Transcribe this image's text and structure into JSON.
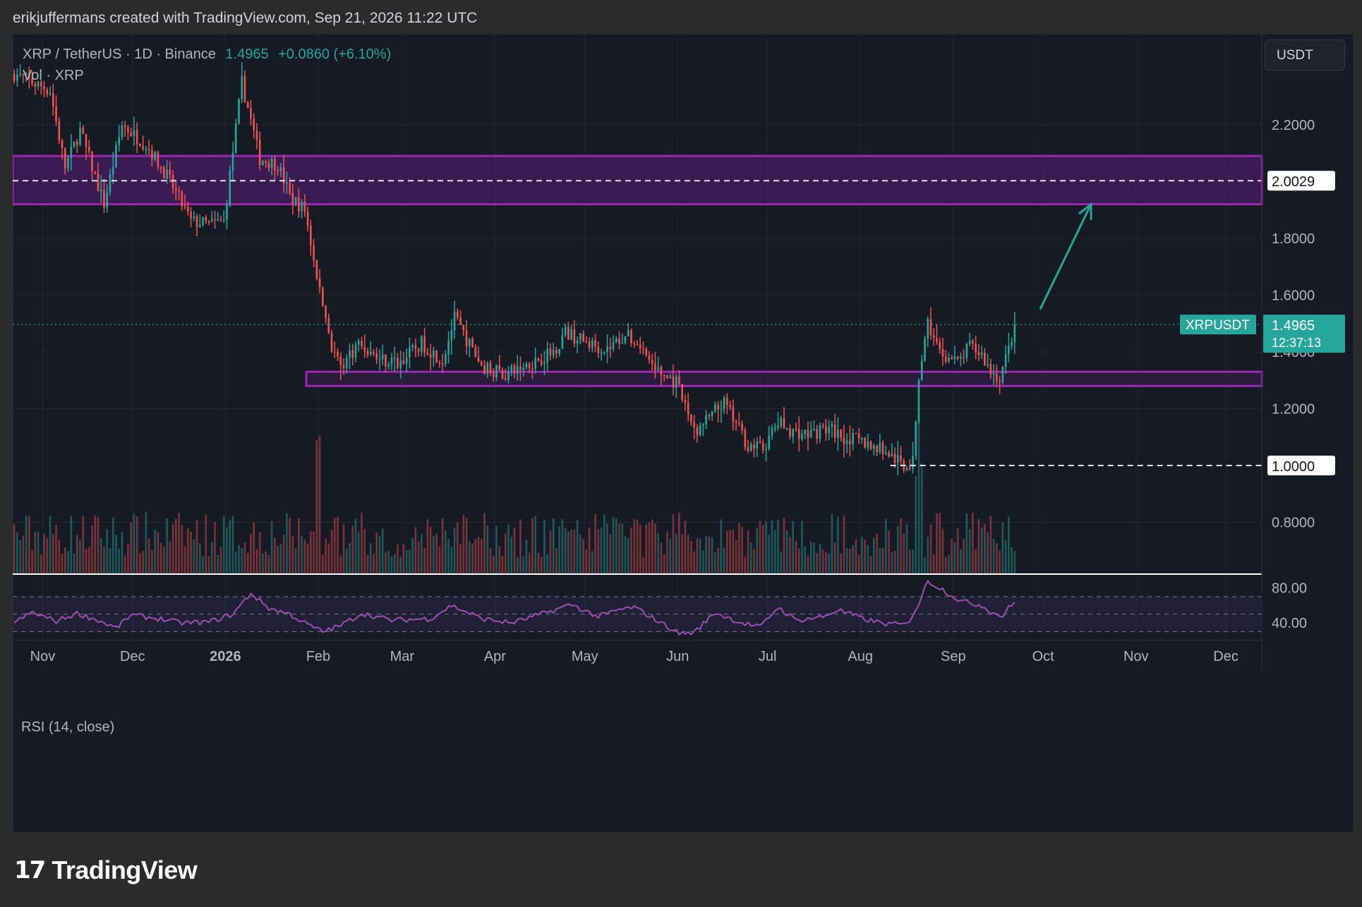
{
  "header": {
    "attribution": "erikjuffermans created with TradingView.com, Sep 21, 2026 11:22 UTC"
  },
  "legend": {
    "symbol": "XRP / TetherUS · 1D · Binance",
    "price": "1.4965",
    "change": "+0.0860 (+6.10%)",
    "volume_label": "Vol · XRP"
  },
  "currency_button": "USDT",
  "rsi_label": "RSI (14, close)",
  "footer": {
    "brand": "TradingView"
  },
  "colors": {
    "up": "#26a69a",
    "down": "#ef5350",
    "zone": "#9c27b0",
    "rsi": "#9c4fb0",
    "background": "#161a25"
  },
  "chart_data": {
    "type": "candlestick",
    "symbol": "XRPUSDT",
    "timeframe": "1D",
    "exchange": "Binance",
    "y_axis": {
      "ticks": [
        "2.2000",
        "1.8000",
        "1.6000",
        "1.4000",
        "1.2000",
        "0.8000"
      ],
      "range": [
        0.62,
        2.52
      ]
    },
    "x_axis": {
      "labels": [
        "Nov",
        "Dec",
        "2026",
        "Feb",
        "Mar",
        "Apr",
        "May",
        "Jun",
        "Jul",
        "Aug",
        "Sep",
        "Oct",
        "Nov",
        "Dec"
      ],
      "dates": [
        "2025-11-01",
        "2025-12-01",
        "2026-01-01",
        "2026-02-01",
        "2026-03-01",
        "2026-04-01",
        "2026-05-01",
        "2026-06-01",
        "2026-07-01",
        "2026-08-01",
        "2026-09-01",
        "2026-10-01",
        "2026-11-01",
        "2026-12-01"
      ],
      "range": [
        "2025-10-22",
        "2026-12-13"
      ]
    },
    "current": {
      "symbol_tag": "XRPUSDT",
      "price": "1.4965",
      "countdown": "12:37:13",
      "value": 1.4965
    },
    "levels": [
      {
        "label": "2.0029",
        "value": 2.0029,
        "start": "2025-10-22"
      },
      {
        "label": "1.0000",
        "value": 1.0,
        "start": "2026-08-11"
      }
    ],
    "zones": [
      {
        "low": 1.92,
        "high": 2.09,
        "start": "2025-10-22",
        "end": "2026-12-13"
      },
      {
        "low": 1.28,
        "high": 1.33,
        "start": "2026-01-28",
        "end": "2026-12-13"
      }
    ],
    "arrow": {
      "from": [
        "2026-09-30",
        1.55
      ],
      "to": [
        "2026-10-17",
        1.92
      ]
    },
    "price_anchors": [
      [
        "2025-10-22",
        2.38
      ],
      [
        "2025-11-03",
        2.32
      ],
      [
        "2025-11-08",
        2.05
      ],
      [
        "2025-11-13",
        2.18
      ],
      [
        "2025-11-21",
        1.92
      ],
      [
        "2025-11-27",
        2.2
      ],
      [
        "2025-12-05",
        2.13
      ],
      [
        "2025-12-12",
        2.02
      ],
      [
        "2025-12-20",
        1.86
      ],
      [
        "2025-12-26",
        1.85
      ],
      [
        "2025-12-31",
        1.86
      ],
      [
        "2026-01-06",
        2.35
      ],
      [
        "2026-01-12",
        2.08
      ],
      [
        "2026-01-18",
        2.06
      ],
      [
        "2026-01-22",
        1.95
      ],
      [
        "2026-01-27",
        1.9
      ],
      [
        "2026-02-01",
        1.62
      ],
      [
        "2026-02-05",
        1.42
      ],
      [
        "2026-02-08",
        1.35
      ],
      [
        "2026-02-14",
        1.43
      ],
      [
        "2026-02-20",
        1.38
      ],
      [
        "2026-02-27",
        1.36
      ],
      [
        "2026-03-07",
        1.43
      ],
      [
        "2026-03-14",
        1.37
      ],
      [
        "2026-03-18",
        1.52
      ],
      [
        "2026-03-27",
        1.35
      ],
      [
        "2026-04-04",
        1.32
      ],
      [
        "2026-04-12",
        1.36
      ],
      [
        "2026-04-20",
        1.4
      ],
      [
        "2026-04-24",
        1.47
      ],
      [
        "2026-05-01",
        1.43
      ],
      [
        "2026-05-08",
        1.41
      ],
      [
        "2026-05-14",
        1.46
      ],
      [
        "2026-05-18",
        1.43
      ],
      [
        "2026-05-25",
        1.33
      ],
      [
        "2026-05-31",
        1.29
      ],
      [
        "2026-06-04",
        1.18
      ],
      [
        "2026-06-07",
        1.12
      ],
      [
        "2026-06-11",
        1.17
      ],
      [
        "2026-06-16",
        1.22
      ],
      [
        "2026-06-24",
        1.07
      ],
      [
        "2026-06-29",
        1.06
      ],
      [
        "2026-07-04",
        1.15
      ],
      [
        "2026-07-09",
        1.12
      ],
      [
        "2026-07-14",
        1.11
      ],
      [
        "2026-07-21",
        1.13
      ],
      [
        "2026-07-26",
        1.1
      ],
      [
        "2026-08-02",
        1.08
      ],
      [
        "2026-08-09",
        1.05
      ],
      [
        "2026-08-15",
        1.0
      ],
      [
        "2026-08-18",
        1.01
      ],
      [
        "2026-08-20",
        1.3
      ],
      [
        "2026-08-23",
        1.5
      ],
      [
        "2026-08-27",
        1.4
      ],
      [
        "2026-09-02",
        1.36
      ],
      [
        "2026-09-06",
        1.42
      ],
      [
        "2026-09-10",
        1.39
      ],
      [
        "2026-09-13",
        1.33
      ],
      [
        "2026-09-16",
        1.31
      ],
      [
        "2026-09-19",
        1.41
      ],
      [
        "2026-09-21",
        1.4965
      ]
    ],
    "rsi": {
      "name": "RSI (14, close)",
      "ticks": [
        "80.00",
        "40.00"
      ],
      "range": [
        20,
        95
      ],
      "upper_band": 70,
      "middle": 50,
      "lower_band": 30,
      "anchors": [
        [
          "2025-10-22",
          40
        ],
        [
          "2025-10-28",
          52
        ],
        [
          "2025-11-05",
          42
        ],
        [
          "2025-11-12",
          51
        ],
        [
          "2025-11-19",
          43
        ],
        [
          "2025-11-25",
          34
        ],
        [
          "2025-11-30",
          49
        ],
        [
          "2025-12-09",
          45
        ],
        [
          "2025-12-17",
          40
        ],
        [
          "2025-12-26",
          41
        ],
        [
          "2026-01-03",
          50
        ],
        [
          "2026-01-09",
          74
        ],
        [
          "2026-01-15",
          57
        ],
        [
          "2026-01-22",
          50
        ],
        [
          "2026-01-28",
          38
        ],
        [
          "2026-02-02",
          30
        ],
        [
          "2026-02-08",
          37
        ],
        [
          "2026-02-15",
          51
        ],
        [
          "2026-02-25",
          43
        ],
        [
          "2026-03-10",
          45
        ],
        [
          "2026-03-17",
          60
        ],
        [
          "2026-03-27",
          45
        ],
        [
          "2026-04-06",
          40
        ],
        [
          "2026-04-16",
          50
        ],
        [
          "2026-04-26",
          61
        ],
        [
          "2026-05-05",
          47
        ],
        [
          "2026-05-12",
          55
        ],
        [
          "2026-05-17",
          58
        ],
        [
          "2026-05-26",
          40
        ],
        [
          "2026-06-01",
          28
        ],
        [
          "2026-06-06",
          29
        ],
        [
          "2026-06-13",
          52
        ],
        [
          "2026-06-21",
          41
        ],
        [
          "2026-06-28",
          35
        ],
        [
          "2026-07-04",
          58
        ],
        [
          "2026-07-10",
          43
        ],
        [
          "2026-07-19",
          47
        ],
        [
          "2026-07-24",
          55
        ],
        [
          "2026-08-02",
          44
        ],
        [
          "2026-08-09",
          39
        ],
        [
          "2026-08-16",
          38
        ],
        [
          "2026-08-20",
          62
        ],
        [
          "2026-08-23",
          88
        ],
        [
          "2026-08-28",
          78
        ],
        [
          "2026-09-03",
          65
        ],
        [
          "2026-09-10",
          60
        ],
        [
          "2026-09-14",
          51
        ],
        [
          "2026-09-17",
          48
        ],
        [
          "2026-09-19",
          57
        ],
        [
          "2026-09-21",
          63
        ]
      ]
    },
    "volume": {
      "name": "Vol · XRP",
      "max_scale": 230
    }
  }
}
